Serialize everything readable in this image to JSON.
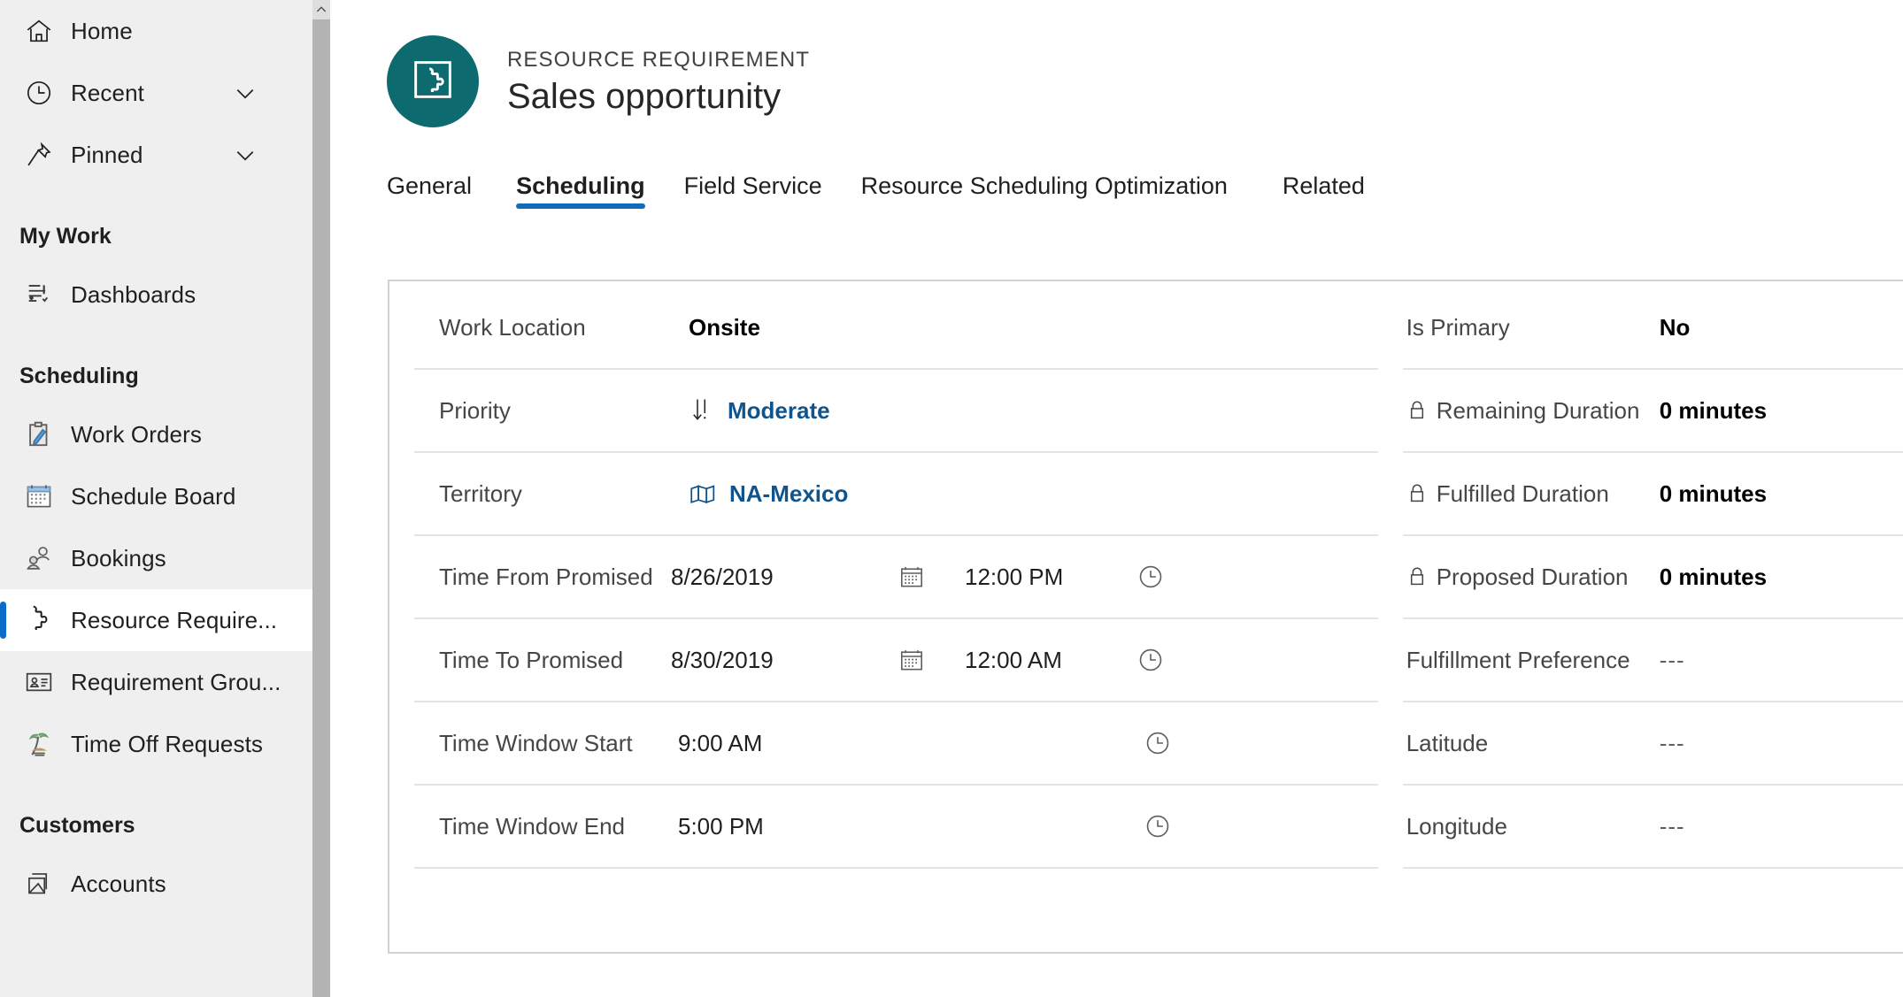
{
  "sidebar": {
    "top_items": [
      {
        "label": "Home",
        "icon": "home-icon",
        "expandable": false
      },
      {
        "label": "Recent",
        "icon": "clock-icon",
        "expandable": true
      },
      {
        "label": "Pinned",
        "icon": "pin-icon",
        "expandable": true
      }
    ],
    "groups": [
      {
        "title": "My Work",
        "items": [
          {
            "label": "Dashboards",
            "icon": "dashboard-icon",
            "selected": false
          }
        ]
      },
      {
        "title": "Scheduling",
        "items": [
          {
            "label": "Work Orders",
            "icon": "clipboard-pencil-icon",
            "selected": false
          },
          {
            "label": "Schedule Board",
            "icon": "calendar-board-icon",
            "selected": false
          },
          {
            "label": "Bookings",
            "icon": "people-icon",
            "selected": false
          },
          {
            "label": "Resource Require...",
            "icon": "puzzle-piece-icon",
            "selected": true
          },
          {
            "label": "Requirement Grou...",
            "icon": "contact-card-icon",
            "selected": false
          },
          {
            "label": "Time Off Requests",
            "icon": "palm-tree-icon",
            "selected": false
          }
        ]
      },
      {
        "title": "Customers",
        "items": [
          {
            "label": "Accounts",
            "icon": "accounts-icon",
            "selected": false
          }
        ]
      }
    ],
    "accent_color": "#0b6bcb",
    "background_color": "#efeff0"
  },
  "record_header": {
    "entity_label": "RESOURCE REQUIREMENT",
    "record_name": "Sales opportunity",
    "entity_icon": "puzzle-piece-icon",
    "entity_icon_background": "#0d6a6e"
  },
  "tabs": {
    "items": [
      {
        "label": "General",
        "active": false
      },
      {
        "label": "Scheduling",
        "active": true
      },
      {
        "label": "Field Service",
        "active": false
      },
      {
        "label": "Resource Scheduling Optimization",
        "active": false
      },
      {
        "label": "Related",
        "active": false
      }
    ],
    "active_underline_color": "#0f6cbd"
  },
  "form": {
    "left_column": [
      {
        "label": "Work Location",
        "value": "Onsite",
        "style": "bold",
        "locked": false
      },
      {
        "label": "Priority",
        "value": "Moderate",
        "style": "link",
        "value_icon": "priority-moderate-icon",
        "locked": false
      },
      {
        "label": "Territory",
        "value": "NA-Mexico",
        "style": "link",
        "value_icon": "map-icon",
        "locked": false
      },
      {
        "label": "Time From Promised",
        "value": "8/26/2019",
        "style": "datetime",
        "date_picker_icon": "calendar-icon",
        "time_value": "12:00 PM",
        "time_picker_icon": "clock-icon",
        "locked": false
      },
      {
        "label": "Time To Promised",
        "value": "8/30/2019",
        "style": "datetime",
        "date_picker_icon": "calendar-icon",
        "time_value": "12:00 AM",
        "time_picker_icon": "clock-icon",
        "locked": false
      },
      {
        "label": "Time Window Start",
        "value": "9:00 AM",
        "style": "time-only",
        "time_picker_icon": "clock-icon",
        "locked": false
      },
      {
        "label": "Time Window End",
        "value": "5:00 PM",
        "style": "time-only",
        "time_picker_icon": "clock-icon",
        "locked": false
      }
    ],
    "right_column": [
      {
        "label": "Is Primary",
        "value": "No",
        "style": "bold",
        "locked": false
      },
      {
        "label": "Remaining Duration",
        "value": "0 minutes",
        "style": "bold",
        "locked": true,
        "lock_icon": "lock-icon"
      },
      {
        "label": "Fulfilled Duration",
        "value": "0 minutes",
        "style": "bold",
        "locked": true,
        "lock_icon": "lock-icon"
      },
      {
        "label": "Proposed Duration",
        "value": "0 minutes",
        "style": "bold",
        "locked": true,
        "lock_icon": "lock-icon"
      },
      {
        "label": "Fulfillment Preference",
        "value": "---",
        "style": "muted",
        "locked": false
      },
      {
        "label": "Latitude",
        "value": "---",
        "style": "muted",
        "locked": false
      },
      {
        "label": "Longitude",
        "value": "---",
        "style": "muted",
        "locked": false
      }
    ],
    "link_color": "#0f548c",
    "row_divider_color": "#e4e4e4",
    "card_border_color": "#d2d2d2"
  },
  "scrollbar": {
    "up_arrow_icon": "chevron-up-icon"
  }
}
